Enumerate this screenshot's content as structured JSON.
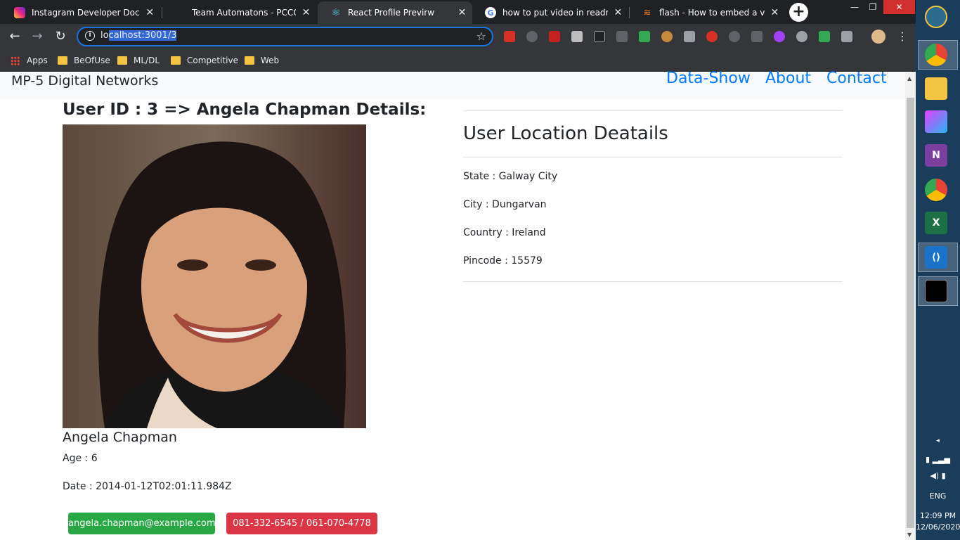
{
  "browser": {
    "tabs": [
      {
        "title": "Instagram Developer Docume",
        "close": "✕",
        "favicon": "instagram-icon"
      },
      {
        "title": "Team Automatons - PCCOE C",
        "close": "✕",
        "favicon": "blank-icon"
      },
      {
        "title": "React Profile Previrw",
        "close": "✕",
        "favicon": "react-icon"
      },
      {
        "title": "how to put video in readme - ",
        "close": "✕",
        "favicon": "google-icon"
      },
      {
        "title": "flash - How to embed a video",
        "close": "✕",
        "favicon": "stackoverflow-icon"
      }
    ],
    "new_tab": "+",
    "window_controls": {
      "minimize": "—",
      "restore": "❐",
      "close": "✕"
    },
    "nav": {
      "back": "←",
      "forward": "→",
      "reload": "↻"
    },
    "address": {
      "prefix": "lo",
      "selected": "calhost:3001/3",
      "info": "i",
      "star": "☆"
    },
    "menu": "⋮",
    "bookmarks": [
      {
        "label": "Apps",
        "icon": "apps-grid-icon"
      },
      {
        "label": "BeOfUse",
        "icon": "folder-icon"
      },
      {
        "label": "ML/DL",
        "icon": "folder-icon"
      },
      {
        "label": "Competitive",
        "icon": "folder-icon"
      },
      {
        "label": "Web",
        "icon": "folder-icon"
      }
    ]
  },
  "navbar": {
    "brand": "MP-5 Digital Networks",
    "links": [
      "Data-Show",
      "About",
      "Contact"
    ]
  },
  "user": {
    "heading": "User ID : 3 => Angela Chapman Details:",
    "name": "Angela Chapman",
    "age": "Age : 6",
    "date": "Date : 2014-01-12T02:01:11.984Z",
    "email": "angela.chapman@example.com",
    "phone": "081-332-6545 / 061-070-4778"
  },
  "location": {
    "title": "User Location Deatails",
    "state": "State : Galway City",
    "city": "City : Dungarvan",
    "country": "Country : Ireland",
    "pincode": "Pincode : 15579"
  },
  "taskbar": {
    "language": "ENG",
    "time": "12:09 PM",
    "date": "12/06/2020",
    "apps": [
      "shell-icon",
      "chrome-icon",
      "file-explorer-icon",
      "app-tile-icon",
      "onenote-icon",
      "chrome-icon",
      "excel-icon",
      "vscode-icon",
      "cmd-icon"
    ]
  },
  "colors": {
    "primary": "#007bff",
    "success": "#28a745",
    "danger": "#dc3545",
    "chrome_dark": "#35363a"
  }
}
